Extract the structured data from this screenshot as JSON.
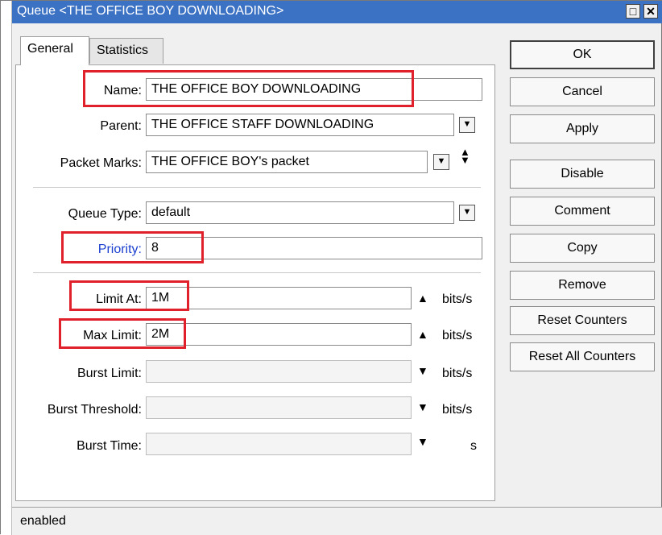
{
  "window": {
    "title": "Queue <THE OFFICE BOY DOWNLOADING>",
    "minimize_label": "□",
    "close_label": "✕"
  },
  "tabs": [
    {
      "label": "General",
      "active": true
    },
    {
      "label": "Statistics",
      "active": false
    }
  ],
  "form": {
    "name": {
      "label": "Name:",
      "value": "THE OFFICE BOY DOWNLOADING"
    },
    "parent": {
      "label": "Parent:",
      "value": "THE OFFICE STAFF DOWNLOADING"
    },
    "packet_marks": {
      "label": "Packet Marks:",
      "value": "THE OFFICE BOY's packet"
    },
    "queue_type": {
      "label": "Queue Type:",
      "value": "default"
    },
    "priority": {
      "label": "Priority:",
      "value": "8"
    },
    "limit_at": {
      "label": "Limit At:",
      "value": "1M",
      "unit": "bits/s"
    },
    "max_limit": {
      "label": "Max Limit:",
      "value": "2M",
      "unit": "bits/s"
    },
    "burst_limit": {
      "label": "Burst Limit:",
      "value": "",
      "unit": "bits/s"
    },
    "burst_threshold": {
      "label": "Burst Threshold:",
      "value": "",
      "unit": "bits/s"
    },
    "burst_time": {
      "label": "Burst Time:",
      "value": "",
      "unit": "s"
    }
  },
  "buttons": {
    "ok": "OK",
    "cancel": "Cancel",
    "apply": "Apply",
    "disable": "Disable",
    "comment": "Comment",
    "copy": "Copy",
    "remove": "Remove",
    "reset_counters": "Reset Counters",
    "reset_all_counters": "Reset All Counters"
  },
  "status": "enabled",
  "colors": {
    "titlebar": "#3c72c4",
    "highlight": "#e0202a",
    "priority_label": "#1a3fd0"
  }
}
